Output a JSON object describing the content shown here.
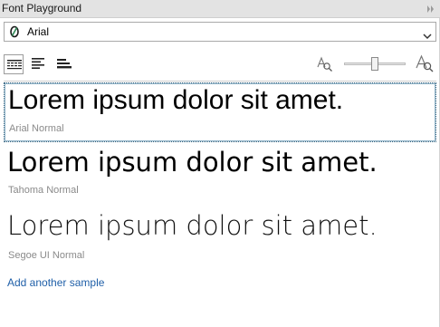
{
  "panel": {
    "title": "Font Playground"
  },
  "font_selector": {
    "value": "Arial"
  },
  "samples": [
    {
      "text": "Lorem ipsum dolor sit amet.",
      "label": "Arial Normal"
    },
    {
      "text": "Lorem ipsum dolor sit amet.",
      "label": "Tahoma Normal"
    },
    {
      "text": "Lorem ipsum dolor sit amet.",
      "label": "Segoe UI Normal"
    }
  ],
  "add_sample_label": "Add another sample",
  "zoom": {
    "level": 0.5
  }
}
